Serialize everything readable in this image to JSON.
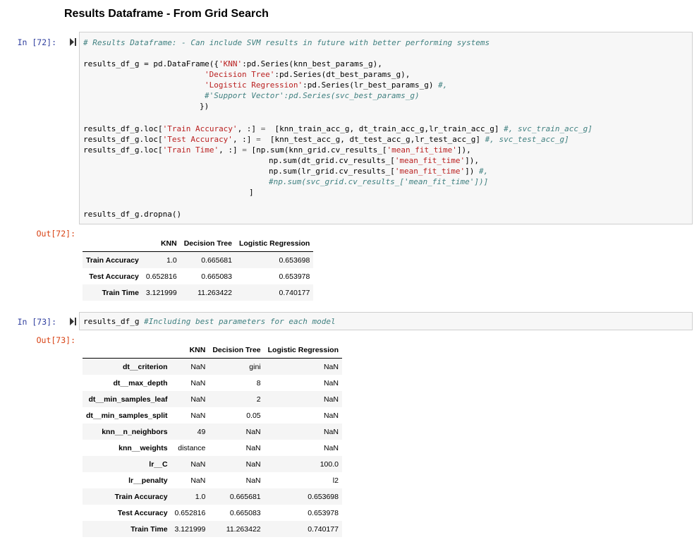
{
  "heading": "Results Dataframe - From Grid Search",
  "cell72": {
    "in_prompt": "In [72]:",
    "out_prompt": "Out[72]:",
    "table": {
      "columns": [
        "",
        "KNN",
        "Decision Tree",
        "Logistic Regression"
      ],
      "rows": [
        [
          "Train Accuracy",
          "1.0",
          "0.665681",
          "0.653698"
        ],
        [
          "Test Accuracy",
          "0.652816",
          "0.665083",
          "0.653978"
        ],
        [
          "Train Time",
          "3.121999",
          "11.263422",
          "0.740177"
        ]
      ]
    }
  },
  "cell73": {
    "in_prompt": "In [73]:",
    "out_prompt": "Out[73]:",
    "table": {
      "columns": [
        "",
        "KNN",
        "Decision Tree",
        "Logistic Regression"
      ],
      "rows": [
        [
          "dt__criterion",
          "NaN",
          "gini",
          "NaN"
        ],
        [
          "dt__max_depth",
          "NaN",
          "8",
          "NaN"
        ],
        [
          "dt__min_samples_leaf",
          "NaN",
          "2",
          "NaN"
        ],
        [
          "dt__min_samples_split",
          "NaN",
          "0.05",
          "NaN"
        ],
        [
          "knn__n_neighbors",
          "49",
          "NaN",
          "NaN"
        ],
        [
          "knn__weights",
          "distance",
          "NaN",
          "NaN"
        ],
        [
          "lr__C",
          "NaN",
          "NaN",
          "100.0"
        ],
        [
          "lr__penalty",
          "NaN",
          "NaN",
          "l2"
        ],
        [
          "Train Accuracy",
          "1.0",
          "0.665681",
          "0.653698"
        ],
        [
          "Test Accuracy",
          "0.652816",
          "0.665083",
          "0.653978"
        ],
        [
          "Train Time",
          "3.121999",
          "11.263422",
          "0.740177"
        ]
      ]
    }
  },
  "code72": {
    "l1": "# Results Dataframe: - Can include SVM results in future with better performing systems",
    "l3a": "results_df_g = pd.DataFrame({",
    "l3b": "'KNN'",
    "l3c": ":pd.Series(knn_best_params_g),",
    "l4a": "'Decision Tree'",
    "l4b": ":pd.Series(dt_best_params_g),",
    "l5a": "'Logistic Regression'",
    "l5b": ":pd.Series(lr_best_params_g) ",
    "l5c": "#,",
    "l6": "#'Support Vector':pd.Series(svc_best_params_g)",
    "l7": "})",
    "l9a": "results_df_g.loc[",
    "l9b": "'Train Accuracy'",
    "l9c": ", :] ",
    "l9d": "=",
    "l9e": "  [knn_train_acc_g, dt_train_acc_g,lr_train_acc_g] ",
    "l9f": "#, svc_train_acc_g]",
    "l10a": "results_df_g.loc[",
    "l10b": "'Test Accuracy'",
    "l10c": ", :] ",
    "l10d": "=",
    "l10e": "  [knn_test_acc_g, dt_test_acc_g,lr_test_acc_g] ",
    "l10f": "#, svc_test_acc_g]",
    "l11a": "results_df_g.loc[",
    "l11b": "'Train Time'",
    "l11c": ", :] ",
    "l11d": "=",
    "l11e": " [np.sum(knn_grid.cv_results_[",
    "l11f": "'mean_fit_time'",
    "l11g": "]),",
    "l12a": "np.sum(dt_grid.cv_results_[",
    "l12b": "'mean_fit_time'",
    "l12c": "]),",
    "l13a": "np.sum(lr_grid.cv_results_[",
    "l13b": "'mean_fit_time'",
    "l13c": "]) ",
    "l13d": "#,",
    "l14": "#np.sum(svc_grid.cv_results_['mean_fit_time'])]",
    "l15": "]",
    "l17": "results_df_g.dropna()"
  },
  "code73": {
    "l1a": "results_df_g ",
    "l1b": "#Including best parameters for each model"
  },
  "icons": {
    "run": "run-cell-icon"
  },
  "colors": {
    "in_prompt": "#303f9f",
    "out_prompt": "#d84315",
    "comment": "#408080",
    "string": "#ba2121"
  }
}
